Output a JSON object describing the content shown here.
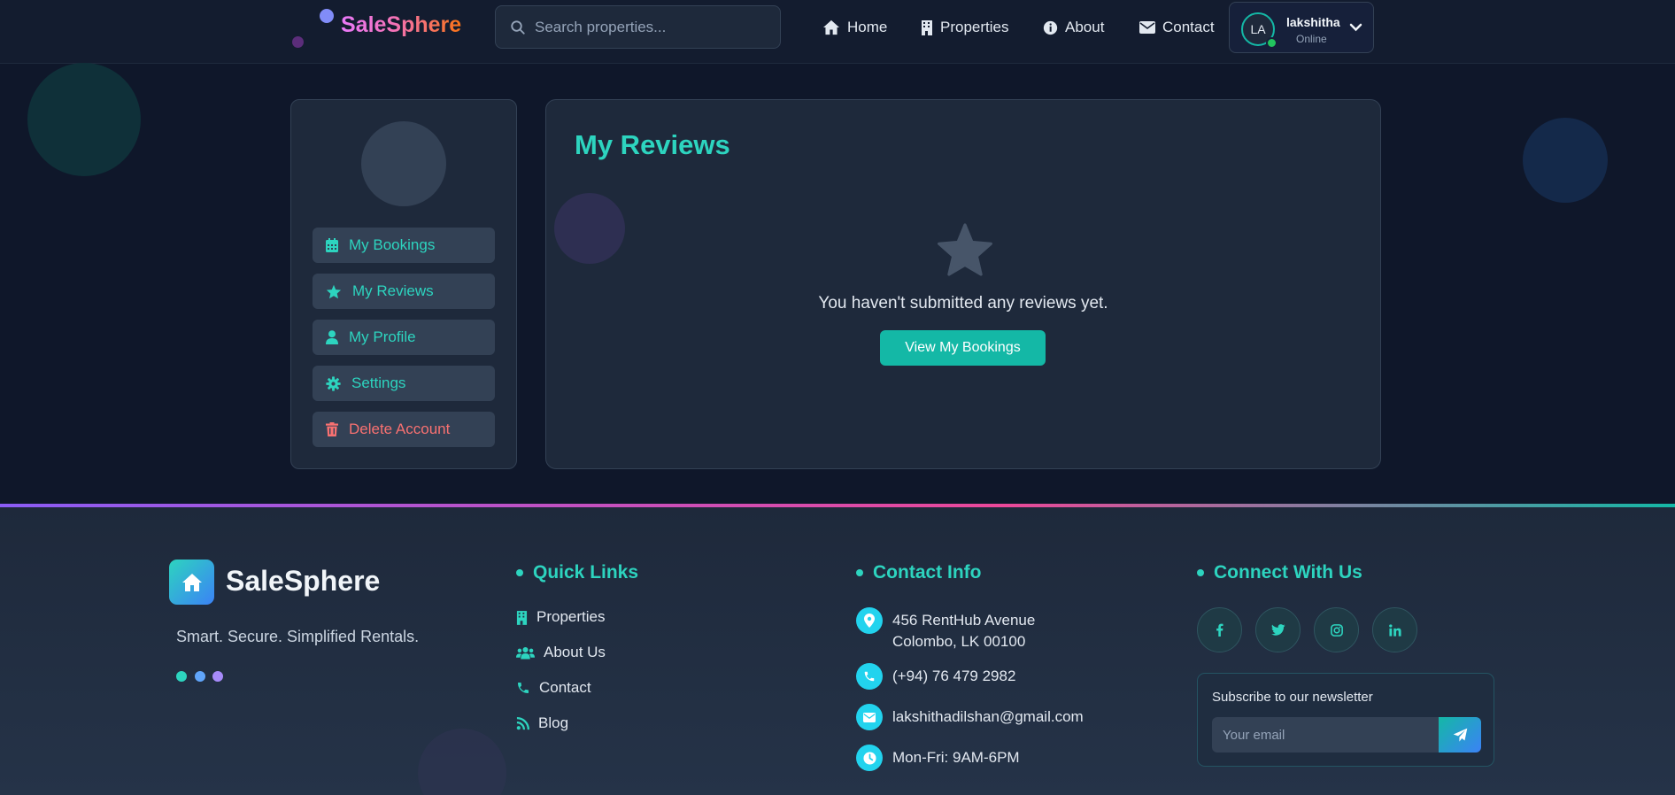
{
  "header": {
    "logo": "SaleSphere",
    "search_placeholder": "Search properties...",
    "nav": [
      {
        "label": "Home",
        "icon": "home-icon"
      },
      {
        "label": "Properties",
        "icon": "building-icon"
      },
      {
        "label": "About",
        "icon": "info-icon"
      },
      {
        "label": "Contact",
        "icon": "envelope-icon"
      }
    ],
    "user": {
      "initials": "LA",
      "name": "lakshitha",
      "status": "Online"
    }
  },
  "sidebar": {
    "items": [
      {
        "label": "My Bookings",
        "icon": "calendar-icon"
      },
      {
        "label": "My Reviews",
        "icon": "star-icon"
      },
      {
        "label": "My Profile",
        "icon": "user-icon"
      },
      {
        "label": "Settings",
        "icon": "gear-icon"
      },
      {
        "label": "Delete Account",
        "icon": "trash-icon"
      }
    ]
  },
  "main": {
    "title": "My Reviews",
    "empty_message": "You haven't submitted any reviews yet.",
    "button_label": "View My Bookings"
  },
  "footer": {
    "brand": "SaleSphere",
    "tagline": "Smart. Secure. Simplified Rentals.",
    "quick_links": {
      "heading": "Quick Links",
      "items": [
        {
          "label": "Properties",
          "icon": "building-icon"
        },
        {
          "label": "About Us",
          "icon": "users-icon"
        },
        {
          "label": "Contact",
          "icon": "phone-icon"
        },
        {
          "label": "Blog",
          "icon": "rss-icon"
        }
      ]
    },
    "contact": {
      "heading": "Contact Info",
      "address_line1": "456 RentHub Avenue",
      "address_line2": "Colombo, LK 00100",
      "phone": "(+94) 76 479 2982",
      "email": "lakshithadilshan@gmail.com",
      "hours": "Mon-Fri: 9AM-6PM"
    },
    "connect": {
      "heading": "Connect With Us",
      "socials": [
        "facebook-icon",
        "twitter-icon",
        "instagram-icon",
        "linkedin-icon"
      ],
      "newsletter_title": "Subscribe to our newsletter",
      "email_placeholder": "Your email"
    }
  },
  "colors": {
    "accent": "#2dd4bf",
    "button": "#14b8a6",
    "danger": "#f87171",
    "background": "#0f172a",
    "card": "#1e293b"
  }
}
